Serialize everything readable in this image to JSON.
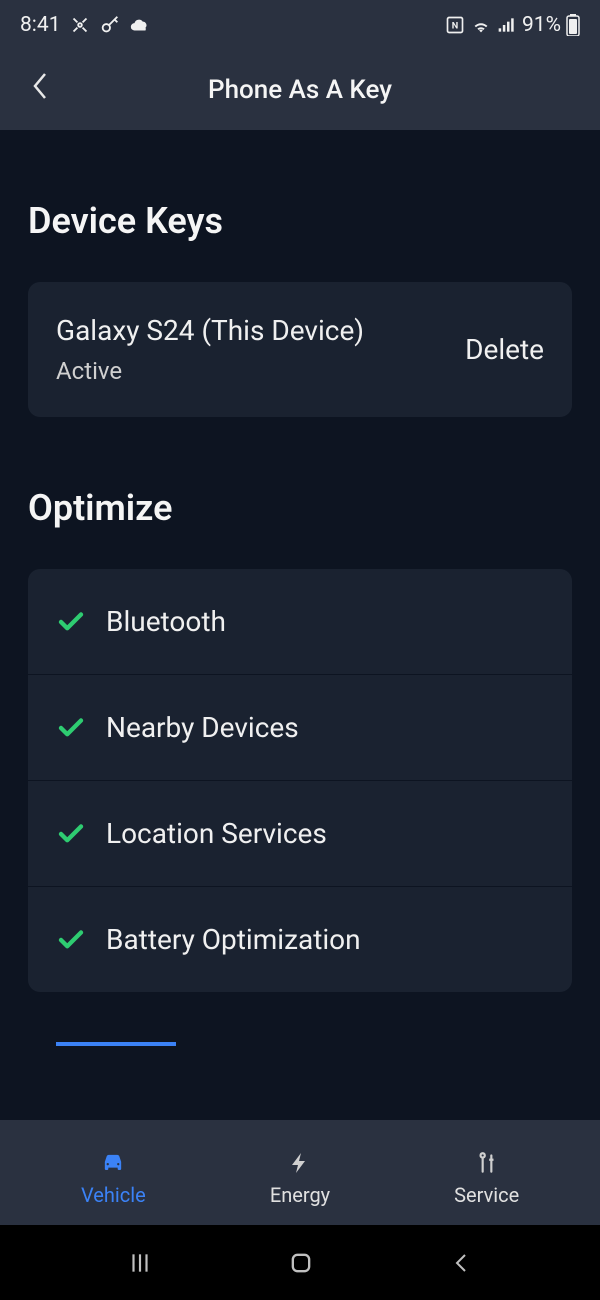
{
  "statusBar": {
    "time": "8:41",
    "battery": "91%"
  },
  "header": {
    "title": "Phone As A Key"
  },
  "deviceKeys": {
    "title": "Device Keys",
    "device": {
      "name": "Galaxy S24 (This Device)",
      "status": "Active",
      "deleteLabel": "Delete"
    }
  },
  "optimize": {
    "title": "Optimize",
    "items": [
      {
        "label": "Bluetooth"
      },
      {
        "label": "Nearby Devices"
      },
      {
        "label": "Location Services"
      },
      {
        "label": "Battery Optimization"
      }
    ]
  },
  "bottomNav": {
    "vehicle": "Vehicle",
    "energy": "Energy",
    "service": "Service"
  }
}
